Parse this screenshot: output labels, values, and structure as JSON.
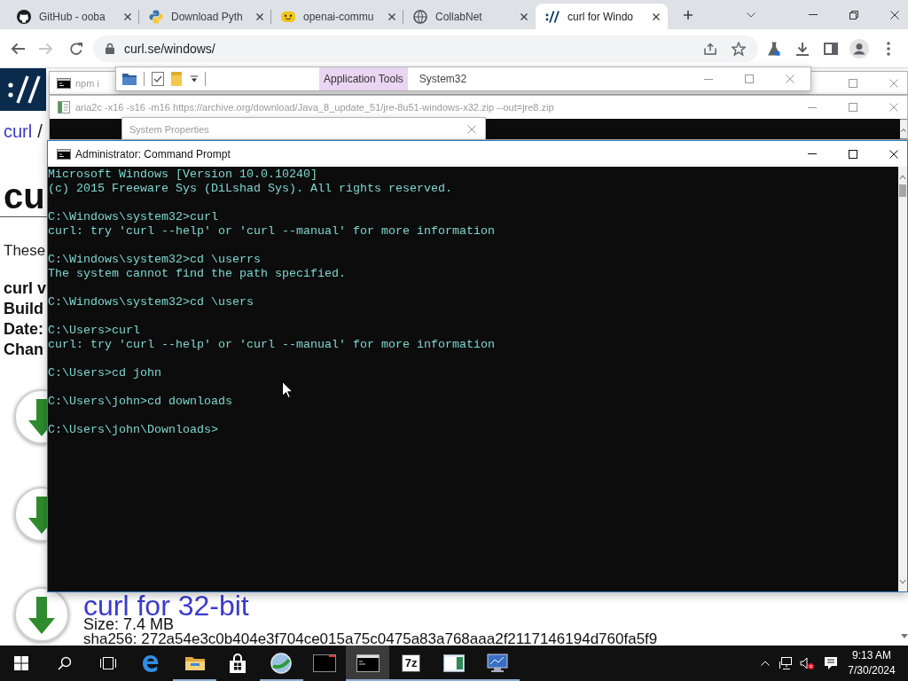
{
  "browser": {
    "tabs": [
      {
        "title": "GitHub - ooba",
        "selected": false
      },
      {
        "title": "Download Pyth",
        "selected": false
      },
      {
        "title": "openai-commu",
        "selected": false
      },
      {
        "title": "CollabNet",
        "selected": false
      },
      {
        "title": "curl for Windo",
        "selected": true
      }
    ],
    "back": {
      "disabled": false
    },
    "forward": {
      "disabled": true
    },
    "address": "curl.se/windows/"
  },
  "page": {
    "breadcrumb_link": "curl",
    "breadcrumb_separator": "/",
    "heading": "cu",
    "intro": "These",
    "details": [
      "curl v",
      "Build",
      "Date:",
      "Chan"
    ],
    "download": {
      "title": "curl for 32-bit",
      "size": "Size: 7.4 MB",
      "checksum": "sha256: 272a54e3c0b404e3f704ce015a75c0475a83a768aaa2f2117146194d760fa5f9"
    }
  },
  "background_windows": [
    {
      "kind": "console",
      "title": "npm i"
    },
    {
      "kind": "explorer",
      "ribbon_tab": "Application Tools",
      "title": "System32"
    },
    {
      "kind": "console",
      "title": "aria2c -x16 -s16 -m16 https://archive.org/download/Java_8_update_51/jre-8u51-windows-x32.zip --out=jre8.zip"
    },
    {
      "kind": "dialog",
      "title": "System Properties"
    }
  ],
  "command_prompt": {
    "title": "Administrator: Command Prompt",
    "blocks": [
      [
        "Microsoft Windows [Version 10.0.10240]",
        "(c) 2015 Freeware Sys (DiLshad Sys). All rights reserved."
      ],
      [
        "C:\\Windows\\system32>curl",
        "curl: try 'curl --help' or 'curl --manual' for more information"
      ],
      [
        "C:\\Windows\\system32>cd \\userrs",
        "The system cannot find the path specified."
      ],
      [
        "C:\\Windows\\system32>cd \\users"
      ],
      [
        "C:\\Users>curl",
        "curl: try 'curl --help' or 'curl --manual' for more information"
      ],
      [
        "C:\\Users>cd john"
      ],
      [
        "C:\\Users\\john>cd downloads"
      ],
      [
        "C:\\Users\\john\\Downloads>"
      ]
    ]
  },
  "taskbar": {
    "apps": [
      {
        "running": false,
        "selected": false
      },
      {
        "running": true,
        "selected": false
      },
      {
        "running": false,
        "selected": false
      },
      {
        "running": true,
        "selected": false
      },
      {
        "running": false,
        "selected": false
      },
      {
        "running": true,
        "selected": true
      },
      {
        "label": "7z",
        "running": true,
        "selected": false
      },
      {
        "running": true,
        "selected": false
      },
      {
        "running": true,
        "selected": false
      }
    ],
    "tray": {
      "volume_muted": true
    },
    "clock": {
      "time": "9:13 AM",
      "date": "7/30/2024"
    }
  }
}
